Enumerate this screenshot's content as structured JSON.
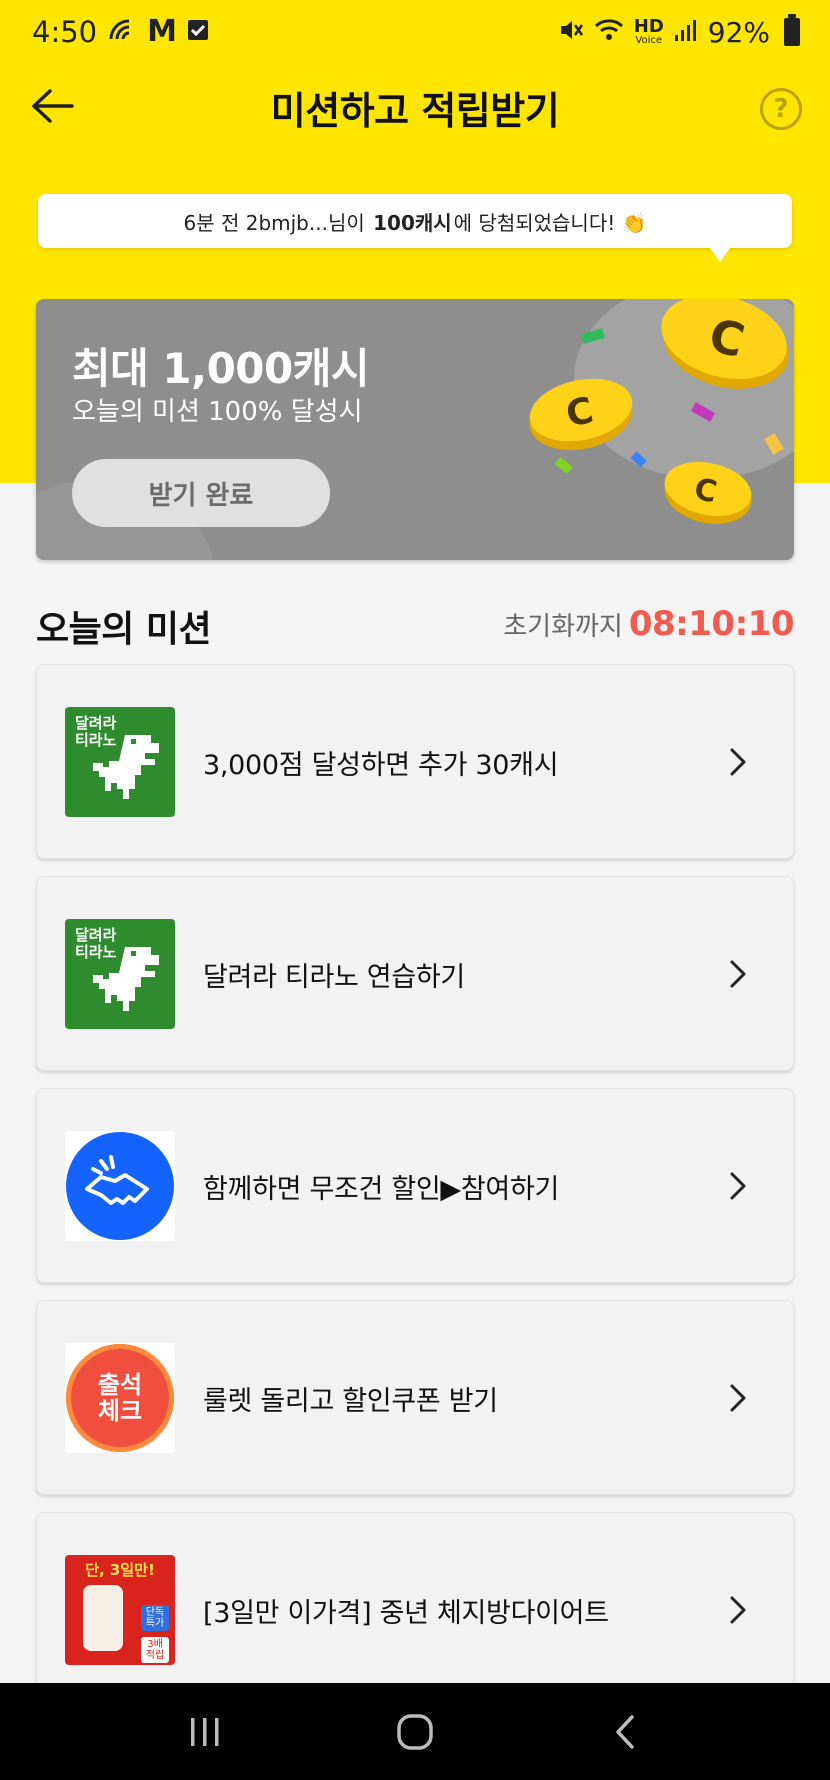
{
  "status_bar": {
    "time": "4:50",
    "left_icons": [
      "wifi-call-icon",
      "gmail-icon",
      "check-square-icon"
    ],
    "hd_label": "HD",
    "voice_label": "Voice",
    "battery": "92%"
  },
  "header": {
    "title": "미션하고 적립받기",
    "help_label": "?"
  },
  "ticker": {
    "prefix": "6분 전 2bmjb...님이 ",
    "amount": "100캐시",
    "suffix": "에 당첨되었습니다! 👏"
  },
  "reward_card": {
    "title": "최대 1,000캐시",
    "subtitle": "오늘의 미션 100% 달성시",
    "button_label": "받기 완료"
  },
  "missions_section": {
    "title": "오늘의 미션",
    "reset_label": "초기화까지",
    "reset_time": "08:10:10"
  },
  "missions": [
    {
      "label": "3,000점 달성하면 추가 30캐시",
      "thumb": "dino-game",
      "thumb_text": [
        "달려라",
        "티라노"
      ]
    },
    {
      "label": "달려라 티라노 연습하기",
      "thumb": "dino-game",
      "thumb_text": [
        "달려라",
        "티라노"
      ]
    },
    {
      "label": "함께하면 무조건 할인▶참여하기",
      "thumb": "handshake"
    },
    {
      "label": "룰렛 돌리고 할인쿠폰 받기",
      "thumb": "attendance-check",
      "thumb_text": [
        "출석",
        "체크"
      ]
    },
    {
      "label": "[3일만 이가격] 중년 체지방다이어트",
      "thumb": "product",
      "thumb_text": [
        "단, 3일만!",
        "단독",
        "특가",
        "3배",
        "적립"
      ]
    }
  ],
  "colors": {
    "brand_yellow": "#FFE600",
    "timer_red": "#f05a4f",
    "card_gray": "#8e8e8e"
  }
}
